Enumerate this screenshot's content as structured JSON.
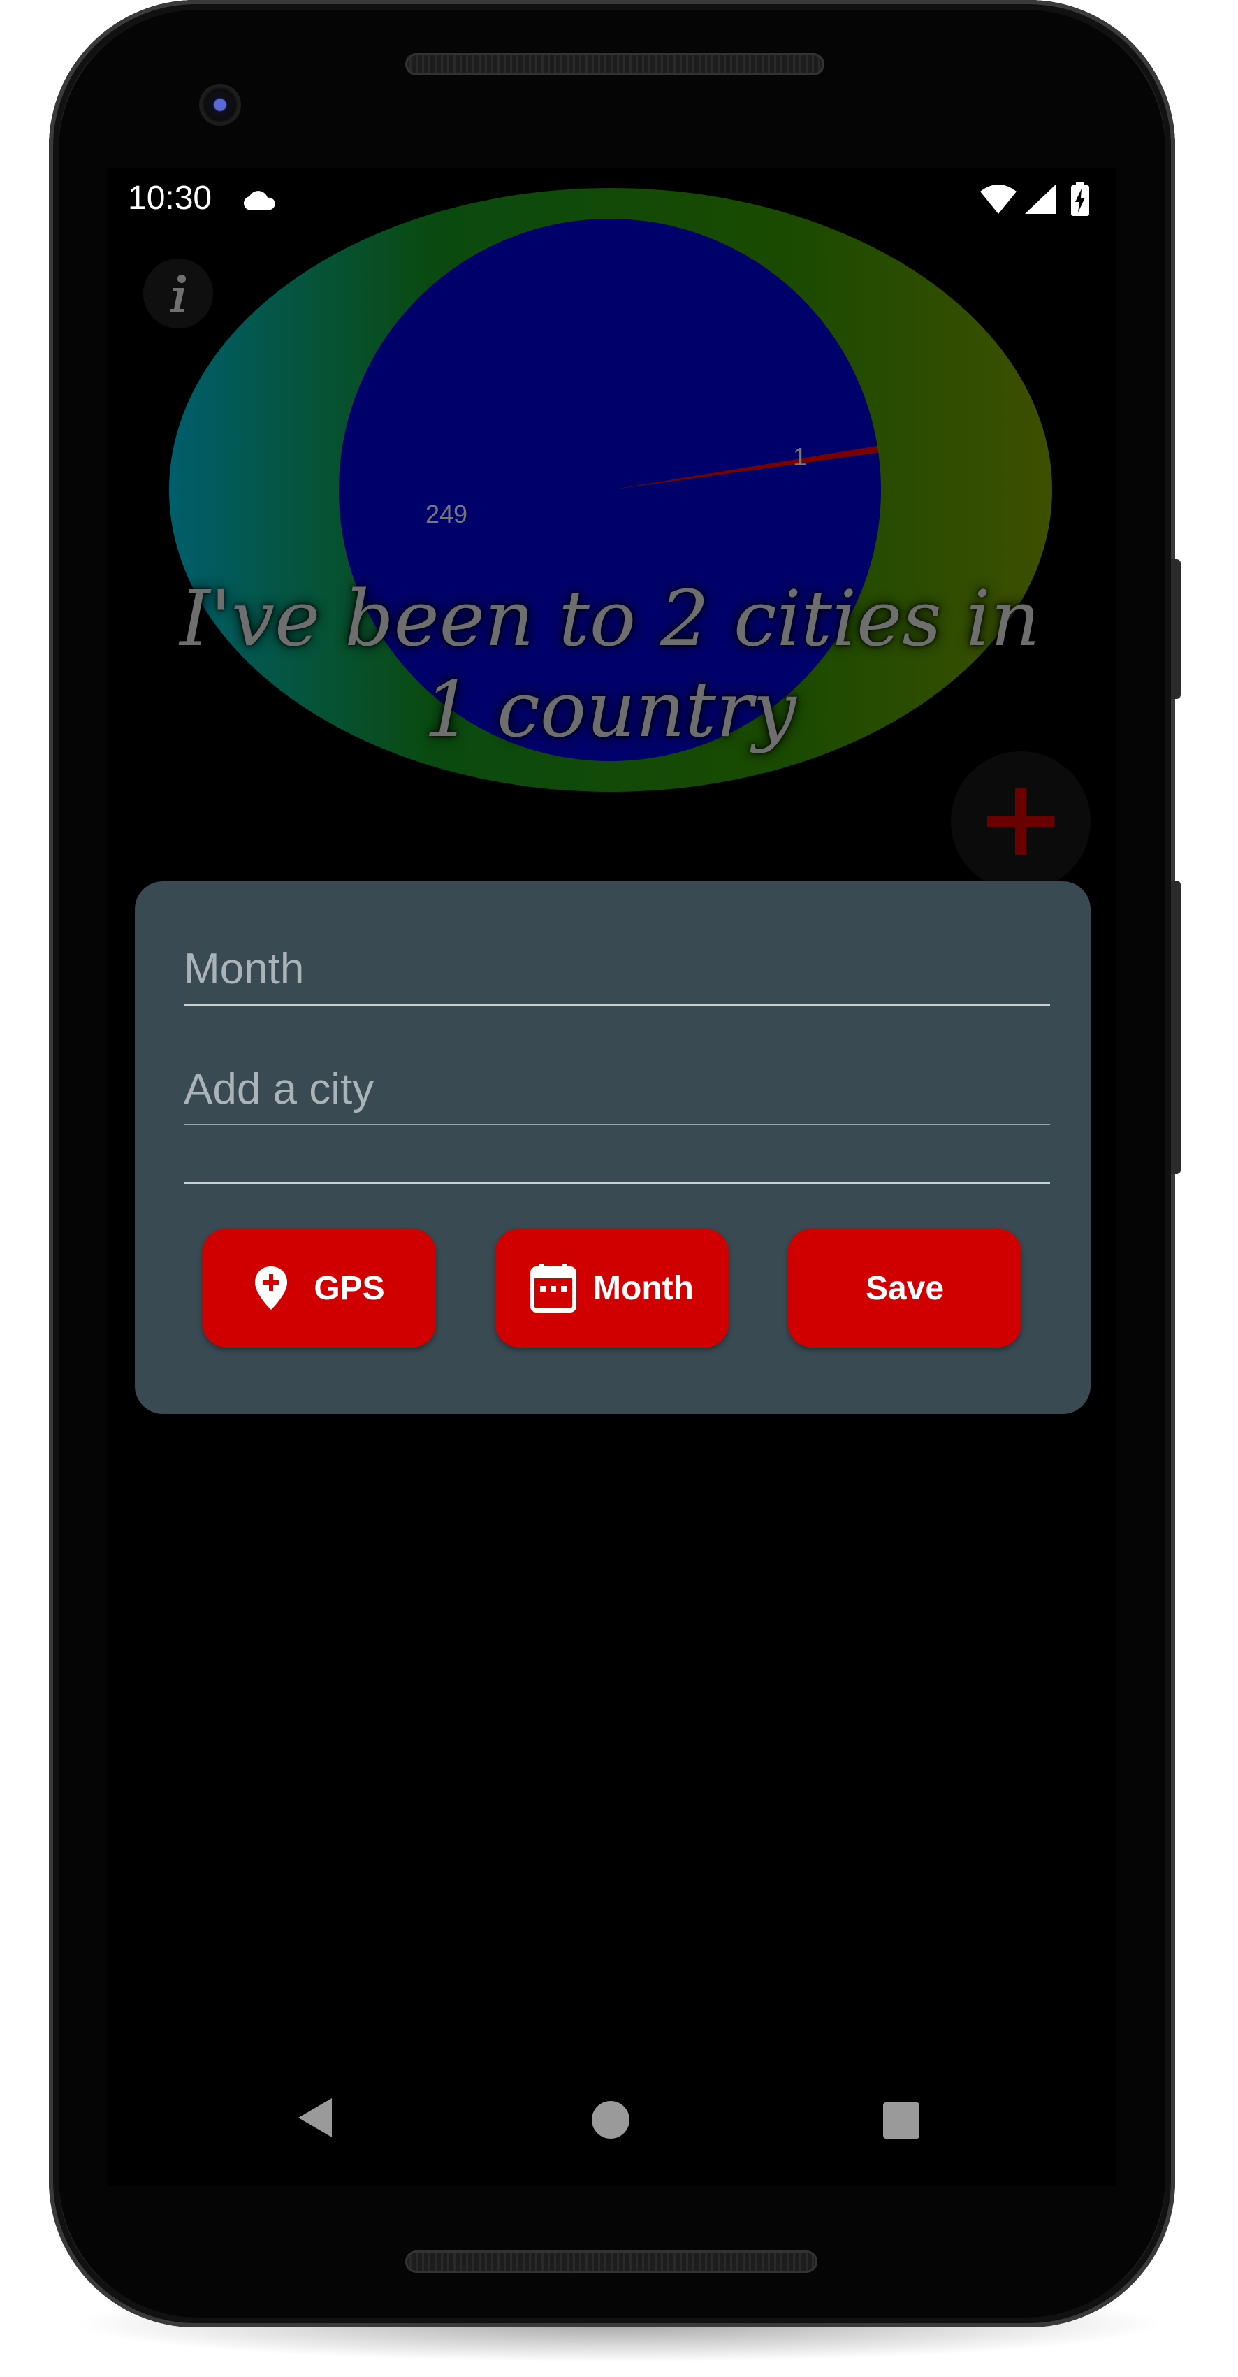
{
  "status_bar": {
    "time": "10:30",
    "icons": [
      "cloud-icon",
      "wifi-icon",
      "signal-icon",
      "battery-charging-icon"
    ]
  },
  "chart_data": {
    "type": "pie",
    "slices": [
      {
        "label": "249",
        "value": 249,
        "color": "#00006a"
      },
      {
        "label": "1",
        "value": 1,
        "color": "#7a0000"
      }
    ],
    "title": "I've been to 2 cities in 1 country"
  },
  "buttons": {
    "info_icon": "info-icon",
    "add_icon": "plus-icon"
  },
  "form": {
    "month_hint": "Month",
    "city_hint": "Add a city",
    "gps_label": "GPS",
    "month_label": "Month",
    "save_label": "Save"
  },
  "colors": {
    "accent": "#d00000",
    "card": "#3a4a52",
    "background": "#000000"
  },
  "nav": {
    "icons": [
      "back-icon",
      "home-icon",
      "recents-icon"
    ]
  }
}
